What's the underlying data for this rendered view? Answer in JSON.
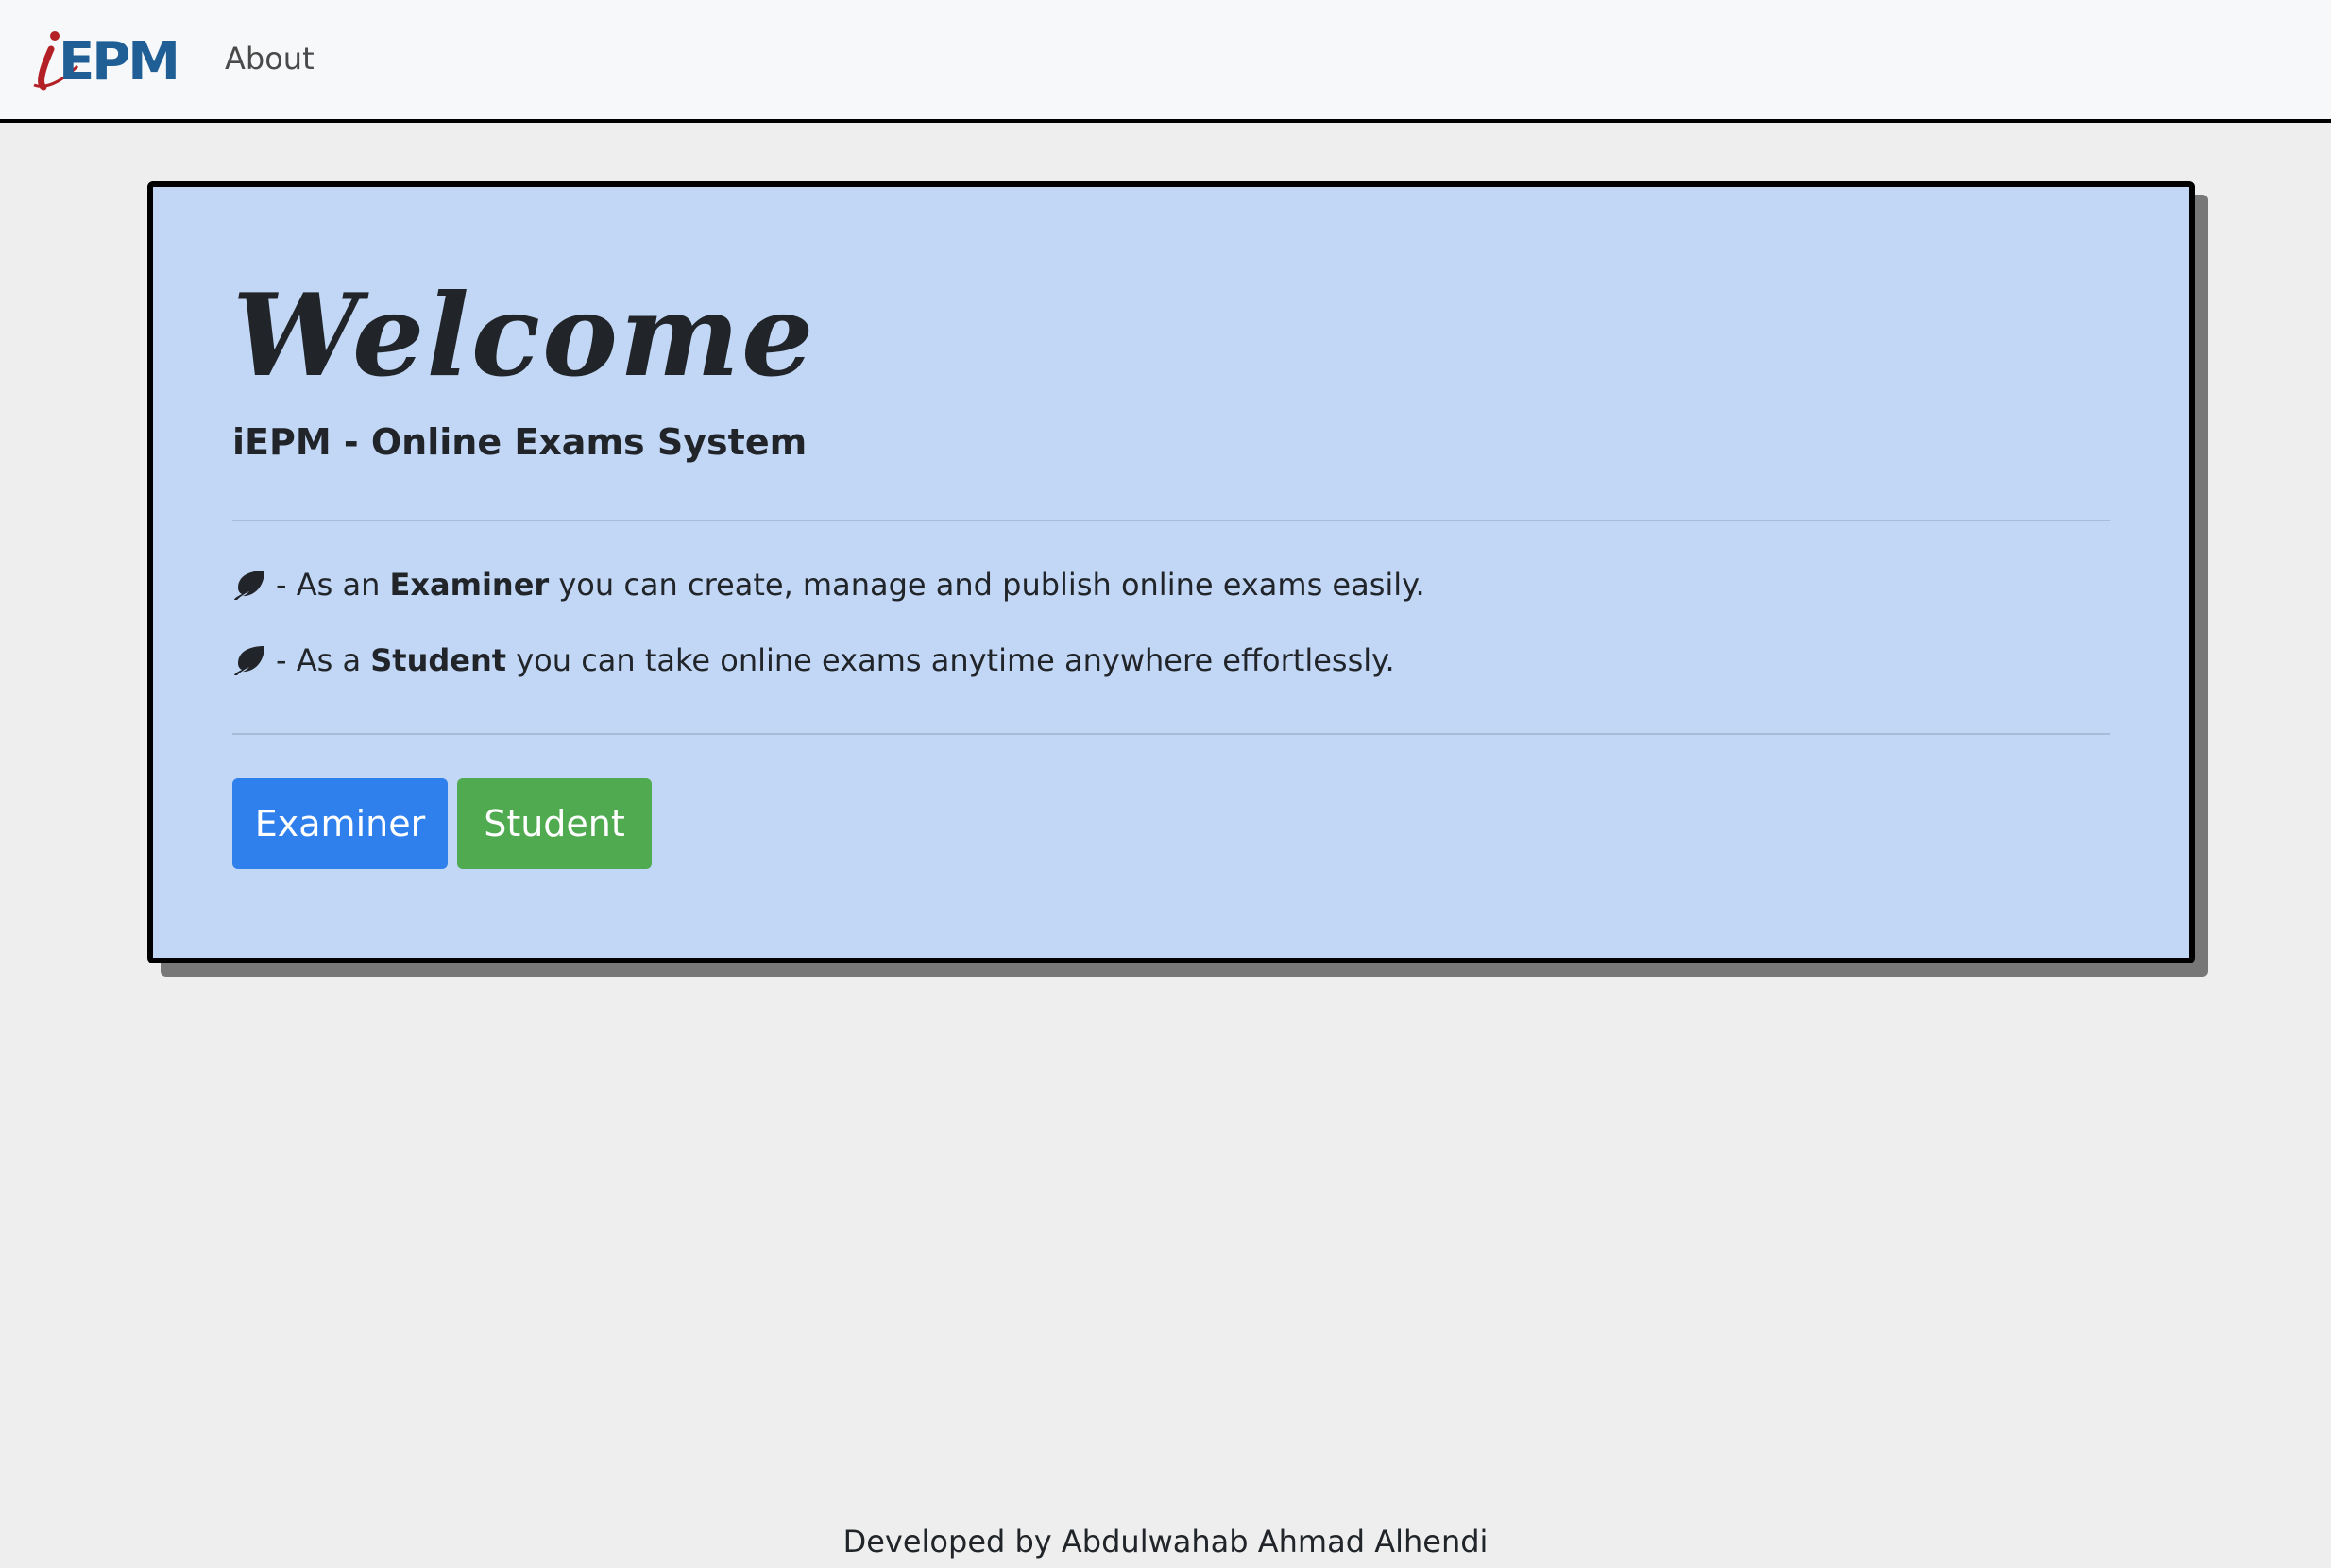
{
  "navbar": {
    "logo_text": "iEPM",
    "links": [
      {
        "label": "About"
      }
    ]
  },
  "card": {
    "heading": "Welcome",
    "subtitle": "iEPM - Online Exams System",
    "features": [
      {
        "icon": "leaf-icon",
        "prefix": "- As an ",
        "emphasis": "Examiner",
        "suffix": " you can create, manage and publish online exams easily."
      },
      {
        "icon": "leaf-icon",
        "prefix": "- As a ",
        "emphasis": "Student",
        "suffix": " you can take online exams anytime anywhere effortlessly."
      }
    ],
    "buttons": {
      "examiner_label": "Examiner",
      "student_label": "Student"
    }
  },
  "footer": {
    "text": "Developed by Abdulwahab Ahmad Alhendi"
  },
  "colors": {
    "page_background": "#eeeeee",
    "navbar_background": "#f7f8fa",
    "card_background": "#c1d7f5",
    "examiner_button": "#2f80ed",
    "student_button": "#4faa50",
    "logo_blue": "#1f5f96",
    "logo_red": "#b32025"
  }
}
